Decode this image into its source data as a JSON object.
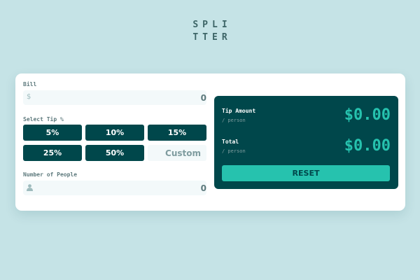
{
  "app": {
    "logo_line1": "SPLI",
    "logo_line2": "TTER"
  },
  "bill": {
    "label": "Bill",
    "icon": "dollar-icon",
    "icon_glyph": "$",
    "value": "0"
  },
  "tip": {
    "label": "Select Tip %",
    "options": [
      "5%",
      "10%",
      "15%",
      "25%",
      "50%"
    ],
    "custom_placeholder": "Custom"
  },
  "people": {
    "label": "Number of People",
    "icon": "person-icon",
    "value": "0"
  },
  "results": {
    "tip_label": "Tip Amount",
    "tip_sub": "/ person",
    "tip_value": "$0.00",
    "total_label": "Total",
    "total_sub": "/ person",
    "total_value": "$0.00",
    "reset_label": "RESET"
  },
  "colors": {
    "background": "#c5e3e6",
    "card": "#ffffff",
    "dark_cyan": "#00474b",
    "strong_cyan": "#26c2ae",
    "input_bg": "#f3f9fa",
    "label_gray": "#5e7a7d"
  }
}
